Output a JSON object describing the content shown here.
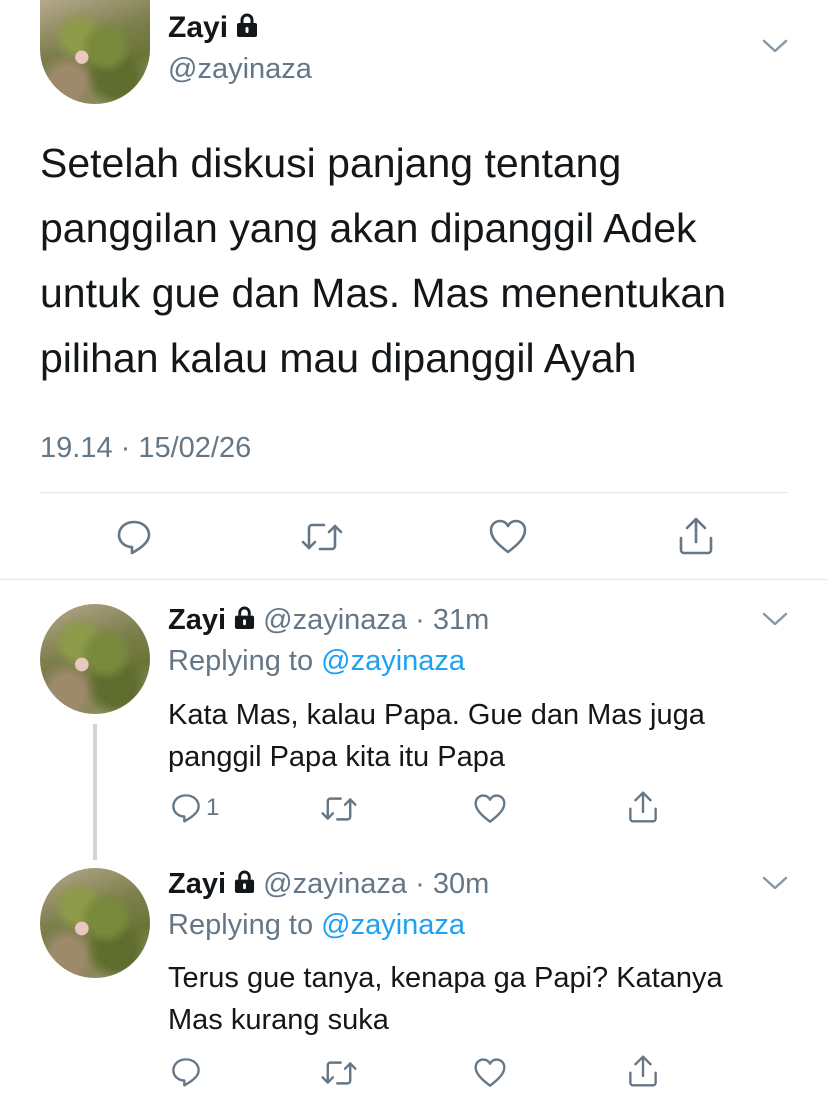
{
  "main_tweet": {
    "display_name": "Zayi",
    "handle": "@zayinaza",
    "lines": [
      "Setelah diskusi panjang tentang",
      "panggilan yang akan dipanggil Adek",
      "untuk gue dan Mas. Mas menentukan",
      "pilihan kalau mau dipanggil Ayah"
    ],
    "timestamp": "19.14 · 15/02/26"
  },
  "replies": [
    {
      "display_name": "Zayi",
      "handle": "@zayinaza",
      "time": "· 31m",
      "replying_prefix": "Replying to",
      "replying_handle": "@zayinaza",
      "lines": [
        "Kata Mas, kalau Papa. Gue dan Mas juga",
        "panggil Papa kita itu Papa"
      ],
      "reply_count": "1"
    },
    {
      "display_name": "Zayi",
      "handle": "@zayinaza",
      "time": "· 30m",
      "replying_prefix": "Replying to",
      "replying_handle": "@zayinaza",
      "lines": [
        "Terus gue tanya, kenapa ga Papi? Katanya",
        "Mas kurang suka"
      ],
      "reply_count": ""
    }
  ],
  "icons": [
    "lock-icon",
    "chevron-down-icon",
    "reply-icon",
    "retweet-icon",
    "like-icon",
    "share-icon"
  ],
  "colors": {
    "text": "#14171a",
    "muted": "#657786",
    "link": "#1da1f2",
    "divider": "#e1e8ed"
  }
}
